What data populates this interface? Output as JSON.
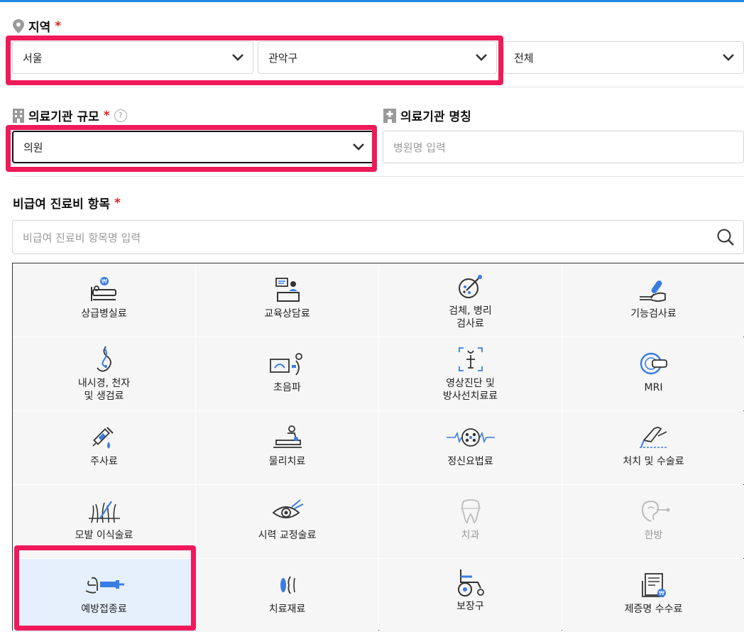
{
  "region": {
    "label": "지역",
    "required_mark": "*",
    "city": "서울",
    "district": "관악구",
    "neighborhood": "전체"
  },
  "facility_size": {
    "label": "의료기관 규모",
    "required_mark": "*",
    "help": "?",
    "value": "의원"
  },
  "facility_name": {
    "label": "의료기관 명칭",
    "placeholder": "병원명 입력"
  },
  "items": {
    "label": "비급여 진료비 항목",
    "required_mark": "*",
    "search_placeholder": "비급여 진료비 항목명 입력"
  },
  "categories": [
    {
      "label": "상급병실료",
      "icon": "hospital-bed-icon"
    },
    {
      "label": "교육상담료",
      "icon": "counseling-icon"
    },
    {
      "label": "검체, 병리\n검사료",
      "icon": "specimen-test-icon"
    },
    {
      "label": "기능검사료",
      "icon": "function-test-icon"
    },
    {
      "label": "내시경, 천자\n및 생검료",
      "icon": "endoscopy-icon"
    },
    {
      "label": "초음파",
      "icon": "ultrasound-icon"
    },
    {
      "label": "영상진단 및\n방사선치료료",
      "icon": "imaging-icon"
    },
    {
      "label": "MRI",
      "icon": "mri-icon"
    },
    {
      "label": "주사료",
      "icon": "syringe-icon"
    },
    {
      "label": "물리치료",
      "icon": "physical-therapy-icon"
    },
    {
      "label": "정신요법료",
      "icon": "psychotherapy-icon"
    },
    {
      "label": "처치 및 수술료",
      "icon": "surgery-icon"
    },
    {
      "label": "모발 이식술료",
      "icon": "hair-transplant-icon"
    },
    {
      "label": "시력 교정술료",
      "icon": "vision-correction-icon"
    },
    {
      "label": "치과",
      "icon": "tooth-icon"
    },
    {
      "label": "한방",
      "icon": "oriental-medicine-icon"
    },
    {
      "label": "예방접종료",
      "icon": "vaccination-icon"
    },
    {
      "label": "치료재료",
      "icon": "treatment-material-icon"
    },
    {
      "label": "보장구",
      "icon": "wheelchair-icon"
    },
    {
      "label": "제증명 수수료",
      "icon": "certificate-icon"
    }
  ],
  "colors": {
    "accent": "#1e88e5",
    "highlight": "#f0195a",
    "required": "#e02020",
    "selected_cell": "#e5f0fc"
  }
}
